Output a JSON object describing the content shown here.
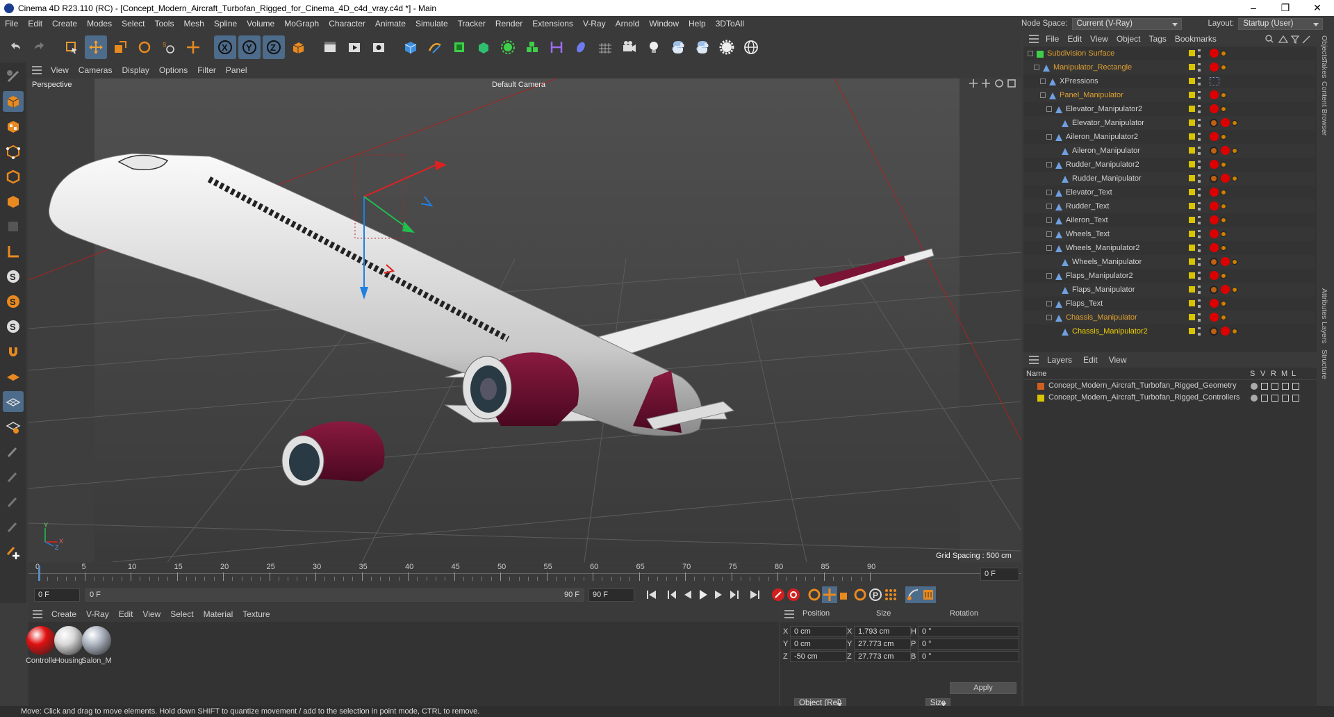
{
  "window": {
    "title": "Cinema 4D R23.110 (RC) - [Concept_Modern_Aircraft_Turbofan_Rigged_for_Cinema_4D_c4d_vray.c4d *] - Main",
    "minimize": "–",
    "maximize": "❐",
    "close": "✕"
  },
  "menu": [
    "File",
    "Edit",
    "Create",
    "Modes",
    "Select",
    "Tools",
    "Mesh",
    "Spline",
    "Volume",
    "MoGraph",
    "Character",
    "Animate",
    "Simulate",
    "Tracker",
    "Render",
    "Extensions",
    "V-Ray",
    "Arnold",
    "Window",
    "Help",
    "3DToAll"
  ],
  "nodespace": {
    "label": "Node Space:",
    "value": "Current (V-Ray)",
    "layout_label": "Layout:",
    "layout_value": "Startup (User)"
  },
  "toolbar": {
    "axis_x": "X",
    "axis_y": "Y",
    "axis_z": "Z"
  },
  "viewport": {
    "menu": [
      "View",
      "Cameras",
      "Display",
      "Options",
      "Filter",
      "Panel"
    ],
    "label": "Perspective",
    "camera": "Default Camera",
    "grid_spacing": "Grid Spacing : 500 cm",
    "axis_x": "X",
    "axis_y": "Y",
    "axis_z": "Z"
  },
  "timeline": {
    "ticks": [
      "0",
      "5",
      "10",
      "15",
      "20",
      "25",
      "30",
      "35",
      "40",
      "45",
      "50",
      "55",
      "60",
      "65",
      "70",
      "75",
      "80",
      "85",
      "90"
    ],
    "end_frame": "0 F"
  },
  "transport": {
    "start": "0 F",
    "current": "0 F",
    "range_end": "90 F",
    "end": "90 F"
  },
  "materials": {
    "menu": [
      "Create",
      "V-Ray",
      "Edit",
      "View",
      "Select",
      "Material",
      "Texture"
    ],
    "items": [
      {
        "name": "Controlle",
        "color": "#e01010"
      },
      {
        "name": "Housing",
        "color": "#d8d8d8"
      },
      {
        "name": "Salon_M",
        "color": "#b0b8c4"
      }
    ]
  },
  "coords": {
    "headers": {
      "position": "Position",
      "size": "Size",
      "rotation": "Rotation"
    },
    "rows": [
      {
        "axis": "X",
        "pos": "0 cm",
        "saxis": "X",
        "size": "1.793 cm",
        "raxis": "H",
        "rot": "0 °"
      },
      {
        "axis": "Y",
        "pos": "0 cm",
        "saxis": "Y",
        "size": "27.773 cm",
        "raxis": "P",
        "rot": "0 °"
      },
      {
        "axis": "Z",
        "pos": "-50 cm",
        "saxis": "Z",
        "size": "27.773 cm",
        "raxis": "B",
        "rot": "0 °"
      }
    ],
    "mode": "Object (Rel)",
    "size_mode": "Size",
    "apply": "Apply"
  },
  "objects": {
    "menu": [
      "File",
      "Edit",
      "View",
      "Object",
      "Tags",
      "Bookmarks"
    ],
    "items": [
      {
        "name": "Subdivision Surface",
        "indent": 0,
        "color": "#e0a030"
      },
      {
        "name": "Manipulator_Rectangle",
        "indent": 1,
        "color": "#e0a030"
      },
      {
        "name": "XPressions",
        "indent": 2,
        "color": "#d0d0d0"
      },
      {
        "name": "Panel_Manipulator",
        "indent": 2,
        "color": "#e0a030"
      },
      {
        "name": "Elevator_Manipulator2",
        "indent": 3,
        "color": "#d0d0d0"
      },
      {
        "name": "Elevator_Manipulator",
        "indent": 4,
        "color": "#d0d0d0"
      },
      {
        "name": "Aileron_Manipulator2",
        "indent": 3,
        "color": "#d0d0d0"
      },
      {
        "name": "Aileron_Manipulator",
        "indent": 4,
        "color": "#d0d0d0"
      },
      {
        "name": "Rudder_Manipulator2",
        "indent": 3,
        "color": "#d0d0d0"
      },
      {
        "name": "Rudder_Manipulator",
        "indent": 4,
        "color": "#d0d0d0"
      },
      {
        "name": "Elevator_Text",
        "indent": 3,
        "color": "#d0d0d0"
      },
      {
        "name": "Rudder_Text",
        "indent": 3,
        "color": "#d0d0d0"
      },
      {
        "name": "Aileron_Text",
        "indent": 3,
        "color": "#d0d0d0"
      },
      {
        "name": "Wheels_Text",
        "indent": 3,
        "color": "#d0d0d0"
      },
      {
        "name": "Wheels_Manipulator2",
        "indent": 3,
        "color": "#d0d0d0"
      },
      {
        "name": "Wheels_Manipulator",
        "indent": 4,
        "color": "#d0d0d0"
      },
      {
        "name": "Flaps_Manipulator2",
        "indent": 3,
        "color": "#d0d0d0"
      },
      {
        "name": "Flaps_Manipulator",
        "indent": 4,
        "color": "#d0d0d0"
      },
      {
        "name": "Flaps_Text",
        "indent": 3,
        "color": "#d0d0d0"
      },
      {
        "name": "Chassis_Manipulator",
        "indent": 3,
        "color": "#e0a030"
      },
      {
        "name": "Chassis_Manipulator2",
        "indent": 4,
        "color": "#f0d000"
      }
    ]
  },
  "layers": {
    "menu": [
      "Layers",
      "Edit",
      "View"
    ],
    "header": {
      "name": "Name",
      "cols": [
        "S",
        "V",
        "R",
        "M",
        "L"
      ]
    },
    "items": [
      {
        "name": "Concept_Modern_Aircraft_Turbofan_Rigged_Geometry",
        "color": "#d06020"
      },
      {
        "name": "Concept_Modern_Aircraft_Turbofan_Rigged_Controllers",
        "color": "#d8c400"
      }
    ]
  },
  "side_tabs": [
    "Objects",
    "Takes",
    "Content Browser",
    "Attributes",
    "Layers",
    "Structure"
  ],
  "status": "Move: Click and drag to move elements. Hold down SHIFT to quantize movement / add to the selection in point mode, CTRL to remove."
}
